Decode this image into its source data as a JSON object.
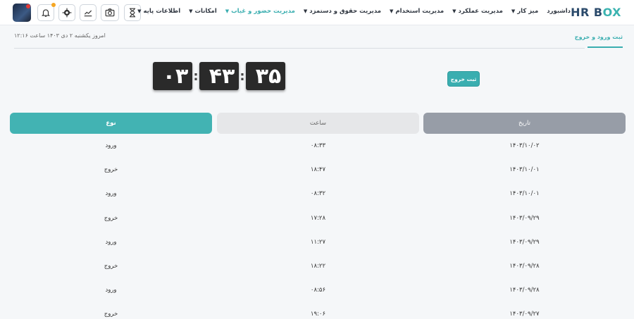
{
  "header": {
    "logo_main": "HR B",
    "logo_accent": "OX",
    "nav": [
      {
        "label": "داشبورد",
        "has_chevron": false,
        "active": false
      },
      {
        "label": "میز کار",
        "has_chevron": true,
        "active": false
      },
      {
        "label": "مدیریت عملکرد",
        "has_chevron": true,
        "active": false
      },
      {
        "label": "مدیریت استخدام",
        "has_chevron": true,
        "active": false
      },
      {
        "label": "مدیریت حقوق و دستمزد",
        "has_chevron": true,
        "active": false
      },
      {
        "label": "مدیریت حضور و غیاب",
        "has_chevron": true,
        "active": true
      },
      {
        "label": "امکانات",
        "has_chevron": true,
        "active": false
      },
      {
        "label": "اطلاعات پایه",
        "has_chevron": true,
        "active": false
      }
    ],
    "icons": [
      "bell-icon",
      "gear-icon",
      "chart-icon",
      "camera-icon",
      "hourglass-icon"
    ]
  },
  "subheader": {
    "tab_label": "ثبت ورود و خروج",
    "date_text": "امروز یکشنبه ۲ دی ۱۴۰۳ ساعت ۱۲:۱۶"
  },
  "clock": {
    "hours": "۰۳",
    "minutes": "۴۳",
    "seconds": "۳۵"
  },
  "exit_button": "ثبت خروج",
  "table": {
    "headers": {
      "type": "نوع",
      "time": "ساعت",
      "date": "تاریخ"
    },
    "rows": [
      {
        "type": "ورود",
        "time": "۰۸:۳۳",
        "date": "۱۴۰۳/۱۰/۰۲"
      },
      {
        "type": "خروج",
        "time": "۱۸:۴۷",
        "date": "۱۴۰۳/۱۰/۰۱"
      },
      {
        "type": "ورود",
        "time": "۰۸:۳۲",
        "date": "۱۴۰۳/۱۰/۰۱"
      },
      {
        "type": "خروج",
        "time": "۱۷:۲۸",
        "date": "۱۴۰۳/۰۹/۲۹"
      },
      {
        "type": "ورود",
        "time": "۱۱:۲۷",
        "date": "۱۴۰۳/۰۹/۲۹"
      },
      {
        "type": "خروج",
        "time": "۱۸:۲۲",
        "date": "۱۴۰۳/۰۹/۲۸"
      },
      {
        "type": "ورود",
        "time": "۰۸:۵۶",
        "date": "۱۴۰۳/۰۹/۲۸"
      },
      {
        "type": "خروج",
        "time": "۱۹:۰۶",
        "date": "۱۴۰۳/۰۹/۲۷"
      }
    ]
  }
}
